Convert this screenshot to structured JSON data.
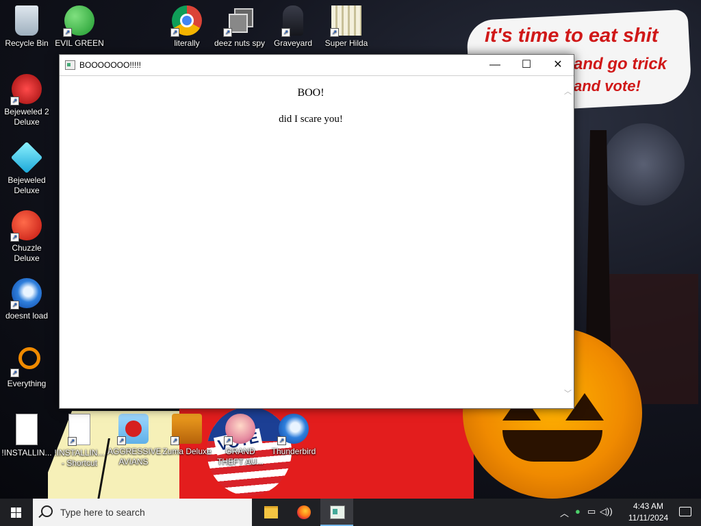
{
  "wallpaper": {
    "sticker_lines": [
      "it's time to eat shit",
      "and go trick",
      "and vote!"
    ],
    "badge_text": "VOTE"
  },
  "desktop_icons": [
    {
      "label": "Recycle Bin",
      "icon": "recycle-bin-icon",
      "shortcut": false
    },
    {
      "label": "EVIL GREEN MEN CO",
      "icon": "green-people-icon",
      "shortcut": true
    },
    {
      "label": "literally",
      "icon": "chrome-icon",
      "shortcut": true
    },
    {
      "label": "deez nuts spy",
      "icon": "window-stack-icon",
      "shortcut": true
    },
    {
      "label": "Graveyard Party S...",
      "icon": "graveyard-icon",
      "shortcut": true
    },
    {
      "label": "Super Hilda",
      "icon": "pixel-cat-icon",
      "shortcut": true
    },
    {
      "label": "Bejeweled 2 Deluxe",
      "icon": "bejeweled2-icon",
      "shortcut": true
    },
    {
      "label": "Bejeweled Deluxe",
      "icon": "diamond-icon",
      "shortcut": true
    },
    {
      "label": "Chuzzle Deluxe",
      "icon": "chuzzle-icon",
      "shortcut": true
    },
    {
      "label": "doesnt load",
      "icon": "thunderbird-icon",
      "shortcut": true
    },
    {
      "label": "Everything",
      "icon": "everything-search-icon",
      "shortcut": true
    },
    {
      "label": "!INSTALLIN...",
      "icon": "text-file-icon",
      "shortcut": false
    },
    {
      "label": "!INSTALLIN... - Shortcut",
      "icon": "text-file-icon",
      "shortcut": true
    },
    {
      "label": "AGGRESSIVE AVIANS",
      "icon": "angry-bird-icon",
      "shortcut": true
    },
    {
      "label": "Zuma Deluxe",
      "icon": "zuma-icon",
      "shortcut": true
    },
    {
      "label": "GRAND THEFT AU...",
      "icon": "anime-girl-icon",
      "shortcut": true
    },
    {
      "label": "Thunderbird",
      "icon": "thunderbird-icon",
      "shortcut": true
    }
  ],
  "window": {
    "title": "BOOOOOOO!!!!!",
    "heading": "BOO!",
    "paragraph": "did I scare you!",
    "controls": {
      "minimize": "—",
      "maximize": "☐",
      "close": "✕"
    }
  },
  "taskbar": {
    "search_placeholder": "Type here to search",
    "apps": [
      "file-explorer-icon",
      "firefox-icon",
      "boo-window-app-icon"
    ],
    "active_app": "boo-window-app-icon",
    "time": "4:43 AM",
    "date": "11/11/2024"
  },
  "colors": {
    "taskbar": "#1f2024",
    "sticker_text": "#d01818",
    "pumpkin": "#f08a00"
  }
}
